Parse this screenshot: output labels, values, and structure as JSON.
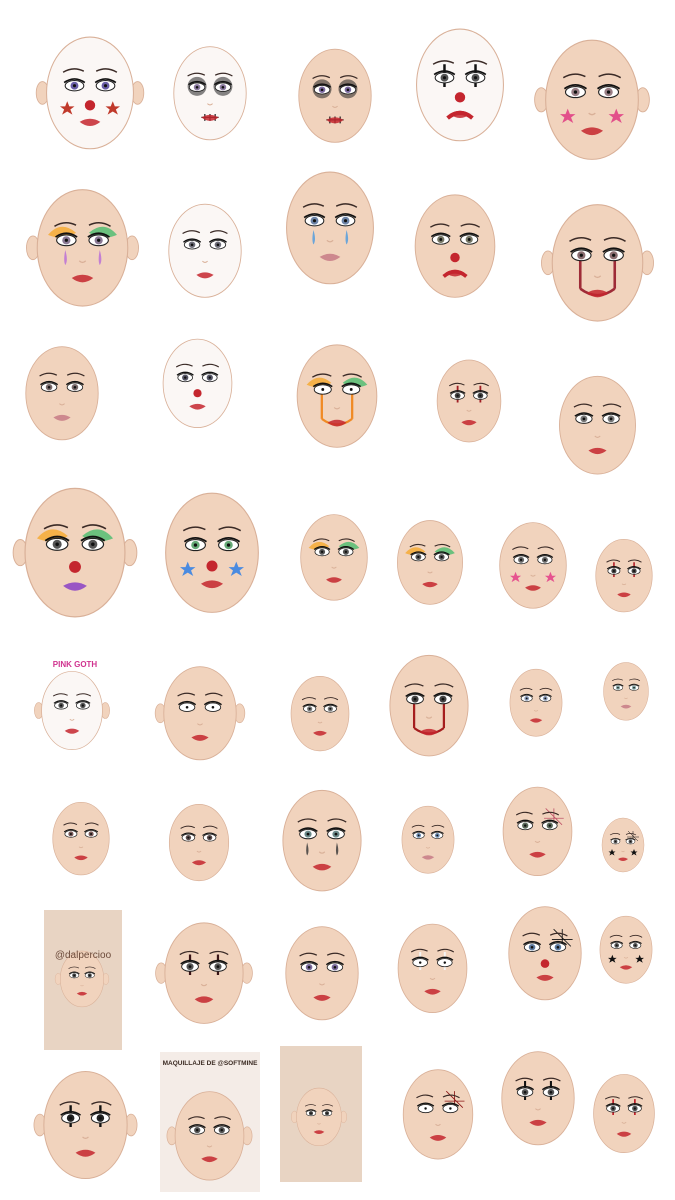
{
  "captions": {
    "pink_goth": "PINK GOTH",
    "dalpercioo": "@dalpercioo",
    "maquillaje": "MAQUILLAJE DE @SOFTMINE"
  },
  "colors": {
    "skin": "#f1d3bd",
    "skin_shadow": "#d9b098",
    "white_base": "#fbf7f5",
    "card": "#e8d4c3",
    "red": "#c4262e",
    "black": "#1b1416",
    "pink": "#f07aa8",
    "blue": "#5b8fd6",
    "purple": "#8a3fc6"
  },
  "faces": [
    {
      "style": "clown-white-stars"
    },
    {
      "style": "skull-white"
    },
    {
      "style": "sugar-skull"
    },
    {
      "style": "harlequin-black"
    },
    {
      "style": "pink-stars"
    },
    {
      "style": "pastel-tears"
    },
    {
      "style": "pierrot-pink"
    },
    {
      "style": "sad-blue-tears"
    },
    {
      "style": "frown-clown"
    },
    {
      "style": "red-drip-eyes"
    },
    {
      "style": "blue-triangle"
    },
    {
      "style": "hearts-clown"
    },
    {
      "style": "rainbow-drip"
    },
    {
      "style": "red-cross-eyes"
    },
    {
      "style": "yellow-triangle"
    },
    {
      "style": "neon-clown"
    },
    {
      "style": "star-clown"
    },
    {
      "style": "rainbow-dots"
    },
    {
      "style": "rainbow-line"
    },
    {
      "style": "pink-stars-small"
    },
    {
      "style": "red-cross-small"
    },
    {
      "style": "pink-goth"
    },
    {
      "style": "swirl-line"
    },
    {
      "style": "black-tribal"
    },
    {
      "style": "red-drip-u"
    },
    {
      "style": "cloud-eyes"
    },
    {
      "style": "blue-waves"
    },
    {
      "style": "soft-red"
    },
    {
      "style": "black-flame"
    },
    {
      "style": "glitter-tears"
    },
    {
      "style": "blue-liner"
    },
    {
      "style": "spiderweb-green"
    },
    {
      "style": "star-spider"
    },
    {
      "style": "dalpercioo"
    },
    {
      "style": "heart-cross"
    },
    {
      "style": "leopard"
    },
    {
      "style": "white-crosses"
    },
    {
      "style": "web-clown"
    },
    {
      "style": "black-stars"
    },
    {
      "style": "stitched-cross"
    },
    {
      "style": "maquillaje-swirl"
    },
    {
      "style": "red-card"
    },
    {
      "style": "web-red"
    },
    {
      "style": "black-cross"
    },
    {
      "style": "red-horns"
    }
  ]
}
